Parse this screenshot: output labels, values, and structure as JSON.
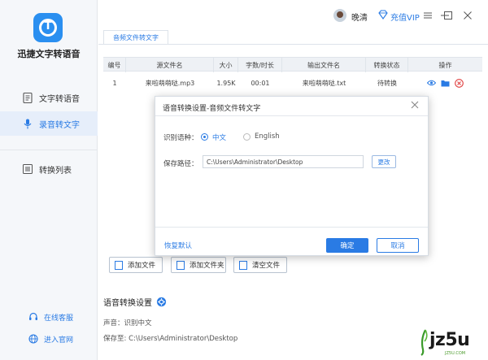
{
  "app": {
    "name": "迅捷文字转语音",
    "brand_color": "#2a8ff0",
    "accent_color": "#2a7be4"
  },
  "sidebar": {
    "items": [
      {
        "label": "文字转语音",
        "icon": "document-icon"
      },
      {
        "label": "录音转文字",
        "icon": "microphone-icon",
        "active": true
      },
      {
        "label": "转换列表",
        "icon": "list-icon"
      }
    ],
    "links": [
      {
        "label": "在线客服",
        "icon": "headset-icon"
      },
      {
        "label": "进入官网",
        "icon": "globe-icon"
      }
    ]
  },
  "topbar": {
    "username": "晚清",
    "vip_label": "充值VIP"
  },
  "tab": {
    "label": "音频文件转文字"
  },
  "table": {
    "headers": [
      "编号",
      "源文件名",
      "大小",
      "字数/时长",
      "输出文件名",
      "转换状态",
      "操作"
    ],
    "rows": [
      [
        "1",
        "来啦萌萌哒.mp3",
        "1.95K",
        "00:01",
        "来啦萌萌哒.txt",
        "待转换"
      ]
    ]
  },
  "buttons": {
    "add_file": "添加文件",
    "add_folder": "添加文件夹",
    "clear_files": "清空文件"
  },
  "settings": {
    "title": "语音转换设置",
    "voice_line": "声音：识别中文",
    "save_line": "保存至: C:\\Users\\Administrator\\Desktop"
  },
  "modal": {
    "title": "语音转换设置-音频文件转文字",
    "language_label": "识别语种：",
    "option_chinese": "中文",
    "option_english": "English",
    "path_label": "保存路径：",
    "path_value": "C:\\Users\\Administrator\\Desktop",
    "change_button": "更改",
    "restore_default": "恢复默认",
    "ok_button": "确定",
    "cancel_button": "取消"
  },
  "watermark": {
    "text": "jz5u",
    "small": "JZ5U.COM"
  }
}
